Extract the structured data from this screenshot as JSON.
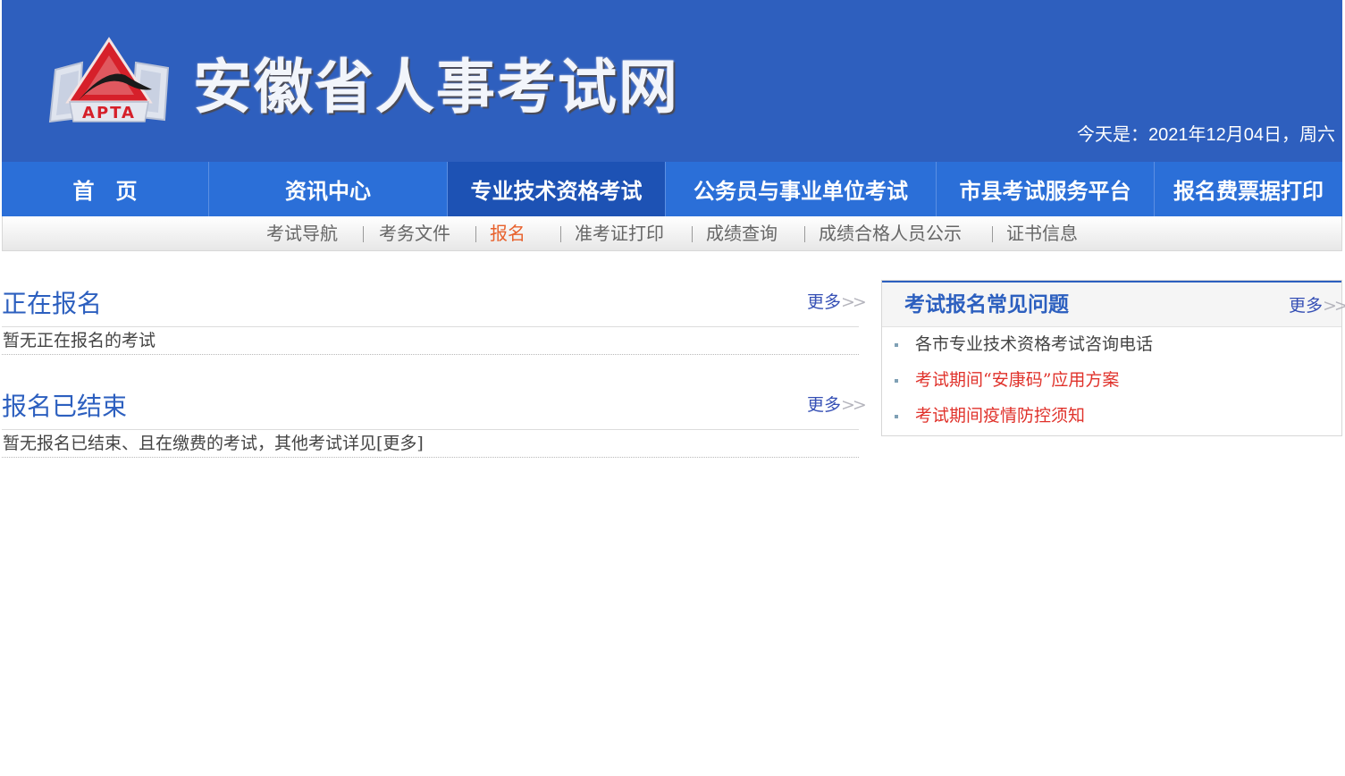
{
  "header": {
    "site_title": "安徽省人事考试网",
    "logo_text": "APTA",
    "date_prefix": "今天是：",
    "date_value": "2021年12月04日，周六"
  },
  "main_nav": [
    {
      "label": "首　页"
    },
    {
      "label": "资讯中心"
    },
    {
      "label": "专业技术资格考试",
      "active": true
    },
    {
      "label": "公务员与事业单位考试"
    },
    {
      "label": "市县考试服务平台"
    },
    {
      "label": "报名费票据打印"
    }
  ],
  "sub_nav": [
    {
      "label": "考试导航"
    },
    {
      "label": "考务文件"
    },
    {
      "label": "报名",
      "active": true
    },
    {
      "label": "准考证打印"
    },
    {
      "label": "成绩查询"
    },
    {
      "label": "成绩合格人员公示"
    },
    {
      "label": "证书信息"
    }
  ],
  "sections": {
    "open": {
      "title": "正在报名",
      "more": "更多",
      "body": "暂无正在报名的考试"
    },
    "closed": {
      "title": "报名已结束",
      "more": "更多",
      "body": "暂无报名已结束、且在缴费的考试，其他考试详见[更多]"
    }
  },
  "faq": {
    "title": "考试报名常见问题",
    "more": "更多",
    "items": [
      {
        "label": "各市专业技术资格考试咨询电话",
        "color": "#444444"
      },
      {
        "label": "考试期间“安康码”应用方案",
        "color": "#e0322b"
      },
      {
        "label": "考试期间疫情防控须知",
        "color": "#e0322b"
      }
    ]
  },
  "colors": {
    "banner": "#2e5fbe",
    "nav": "#2b6fd8",
    "nav_active": "#1d52b4",
    "accent": "#2c5fbf",
    "sub_active": "#e8612c",
    "alert": "#e0322b"
  }
}
